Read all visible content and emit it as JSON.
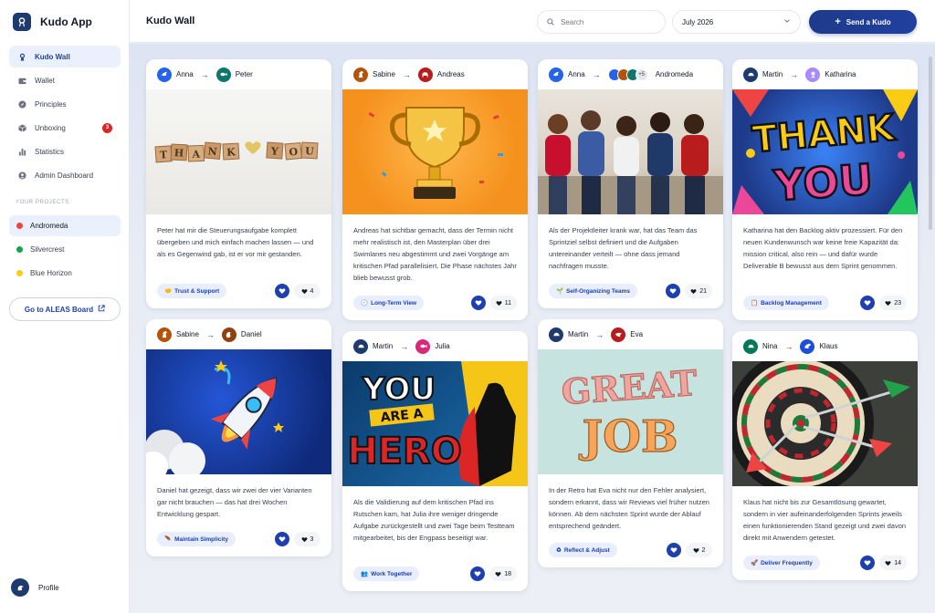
{
  "app": {
    "name": "Kudo App"
  },
  "sidebar": {
    "nav": [
      {
        "label": "Kudo Wall",
        "icon": "kudo-icon",
        "active": true
      },
      {
        "label": "Wallet",
        "icon": "wallet-icon"
      },
      {
        "label": "Principles",
        "icon": "compass-icon"
      },
      {
        "label": "Unboxing",
        "icon": "box-icon",
        "badge": "3"
      },
      {
        "label": "Statistics",
        "icon": "chart-icon"
      },
      {
        "label": "Admin Dashboard",
        "icon": "admin-icon"
      }
    ],
    "projects_label": "YOUR PROJECTS",
    "projects": [
      {
        "label": "Andromeda",
        "color": "#ef4444",
        "active": true
      },
      {
        "label": "Silvercrest",
        "color": "#16a34a"
      },
      {
        "label": "Blue Horizon",
        "color": "#facc15"
      }
    ],
    "aleas_button": "Go to ALEAS Board",
    "profile_label": "Profile"
  },
  "header": {
    "title": "Kudo Wall",
    "search_placeholder": "Search",
    "month": "July 2026",
    "send_button": "Send a Kudo"
  },
  "cards": [
    {
      "from": "Anna",
      "to": "Peter",
      "text": "Peter hat mir die Steuerungsaufgabe komplett übergeben und mich einfach machen lassen — und als es Gegenwind gab, ist er vor mir gestanden.",
      "tag": "Trust & Support",
      "tag_icon": "handshake-icon",
      "likes": "4"
    },
    {
      "from": "Sabine",
      "to": "Andreas",
      "text": "Andreas hat sichtbar gemacht, dass der Termin nicht mehr realistisch ist, den Masterplan über drei Swimlanes neu abgestimmt und zwei Vorgänge am kritischen Pfad parallelisiert. Die Phase nächstes Jahr blieb bewusst grob.",
      "tag": "Long-Term View",
      "tag_icon": "clock-icon",
      "likes": "11"
    },
    {
      "from": "Anna",
      "to": "Andromeda",
      "extra": "+5",
      "text": "Als der Projektleiter krank war, hat das Team das Sprintziel selbst definiert und die Aufgaben untereinander verteilt — ohne dass jemand nachfragen musste.",
      "tag": "Self-Organizing Teams",
      "tag_icon": "plant-icon",
      "likes": "21"
    },
    {
      "from": "Martin",
      "to": "Katharina",
      "text": "Katharina hat den Backlog aktiv prozessiert. Für den neuen Kundenwunsch war keine freie Kapazität da: mission critical, also rein — und dafür wurde Deliverable B bewusst aus dem Sprint genommen.",
      "tag": "Backlog Management",
      "tag_icon": "clipboard-icon",
      "likes": "23"
    },
    {
      "from": "Sabine",
      "to": "Daniel",
      "text": "Daniel hat gezeigt, dass wir zwei der vier Varianten gar nicht brauchen — das hat drei Wochen Entwicklung gespart.",
      "tag": "Maintain Simplicity",
      "tag_icon": "feather-icon",
      "likes": "3"
    },
    {
      "from": "Martin",
      "to": "Julia",
      "text": "Als die Validierung auf dem kritischen Pfad ins Rutschen kam, hat Julia ihre weniger dringende Aufgabe zurückgestellt und zwei Tage beim Testteam mitgearbeitet, bis der Engpass beseitigt war.",
      "tag": "Work Together",
      "tag_icon": "people-icon",
      "likes": "18"
    },
    {
      "from": "Martin",
      "to": "Eva",
      "text": "In der Retro hat Eva nicht nur den Fehler analysiert, sondern erkannt, dass wir Reviews viel früher nutzen können. Ab dem nächsten Sprint wurde der Ablauf entsprechend geändert.",
      "tag": "Reflect & Adjust",
      "tag_icon": "recycle-icon",
      "likes": "2"
    },
    {
      "from": "Nina",
      "to": "Klaus",
      "text": "Klaus hat nicht bis zur Gesamtlösung gewartet, sondern in vier aufeinanderfolgenden Sprints jeweils einen funktionierenden Stand gezeigt und zwei davon direkt mit Anwendern getestet.",
      "tag": "Deliver Frequently",
      "tag_icon": "rocket-icon",
      "likes": "14"
    }
  ],
  "image_texts": {
    "thank_you_blocks": [
      "T",
      "H",
      "A",
      "N",
      "K",
      "",
      "Y",
      "O",
      "U"
    ],
    "thank_you_comic_1": "THANK",
    "thank_you_comic_2": "YOU",
    "hero_1": "YOU",
    "hero_2": "ARE A",
    "hero_3": "HERO",
    "great": "GREAT",
    "job": "JOB"
  },
  "colors": {
    "primary": "#1e40af",
    "navy": "#1e3a6e",
    "badge_red": "#dc2626"
  }
}
